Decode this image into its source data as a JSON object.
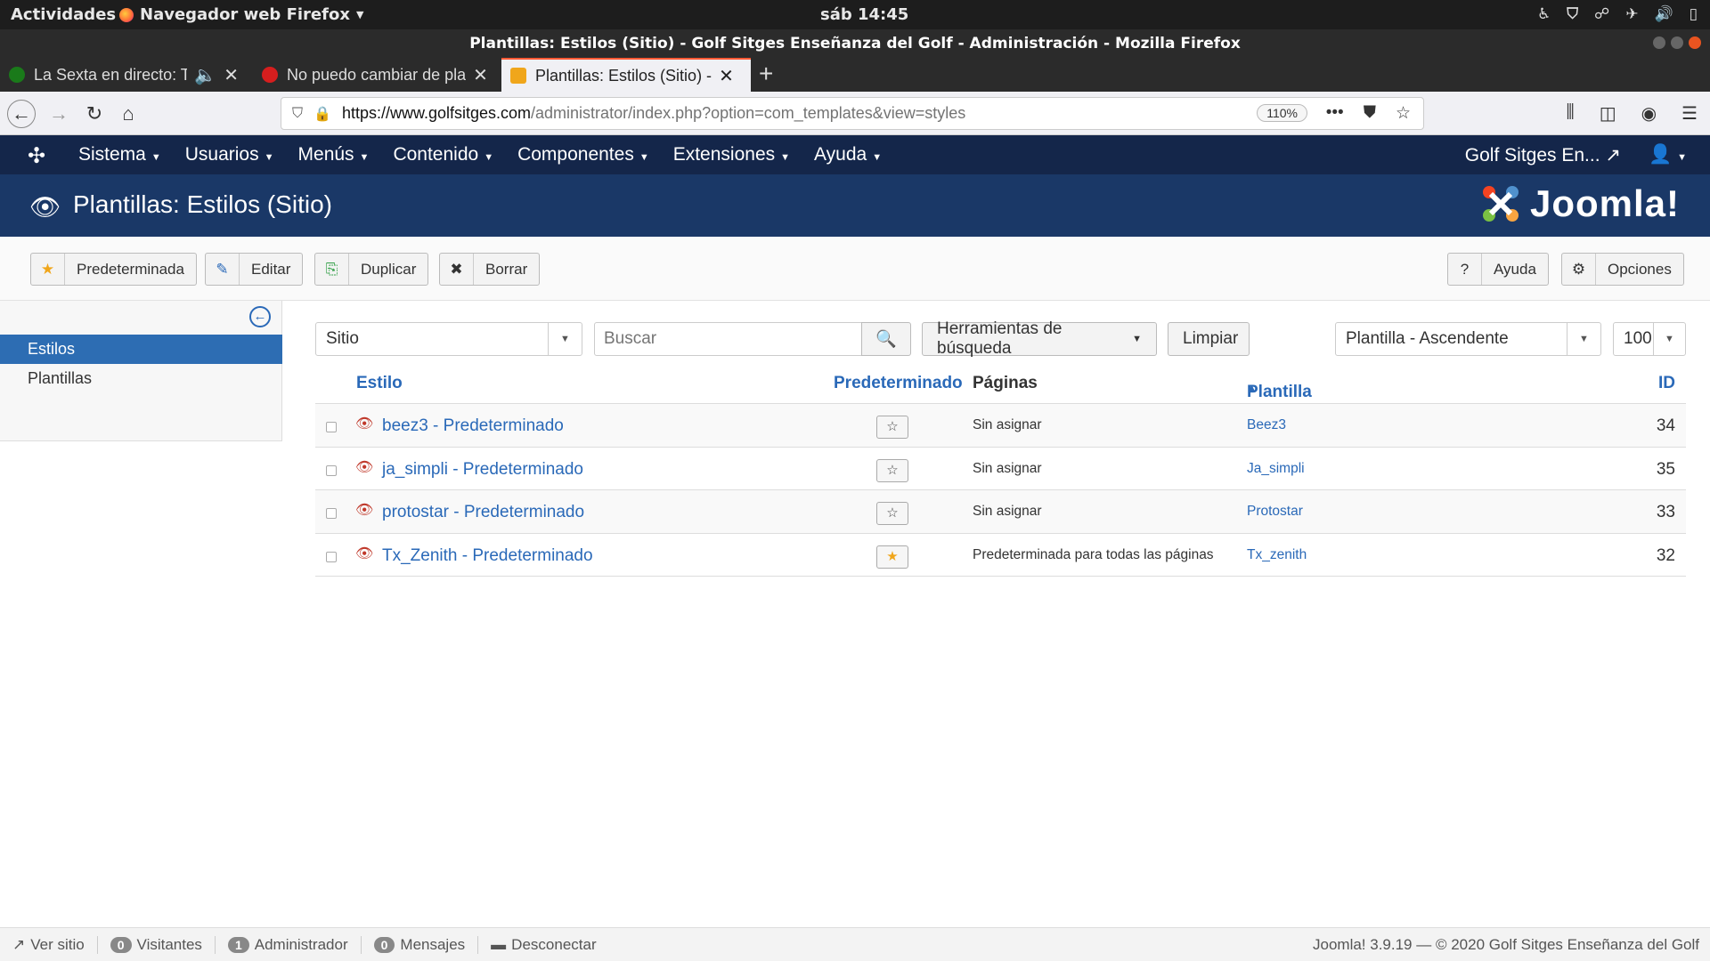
{
  "os": {
    "activities": "Actividades",
    "app_menu": "Navegador web Firefox",
    "clock": "sáb 14:45"
  },
  "browser": {
    "window_title": "Plantillas: Estilos (Sitio) - Golf Sitges Enseñanza del Golf - Administración - Mozilla Firefox",
    "tabs": [
      {
        "label": "La Sexta en directo: To",
        "icon_color": "#1a7a1a"
      },
      {
        "label": "No puedo cambiar de pla",
        "icon_color": "#d61e1e"
      },
      {
        "label": "Plantillas: Estilos (Sitio) -",
        "icon_color": "#f0a61b"
      }
    ],
    "url_host": "https://www.golfsitges.com",
    "url_path": "/administrator/index.php?option=com_templates&view=styles",
    "zoom": "110%"
  },
  "admin_nav": {
    "menu": [
      "Sistema",
      "Usuarios",
      "Menús",
      "Contenido",
      "Componentes",
      "Extensiones",
      "Ayuda"
    ],
    "site_link": "Golf Sitges En..."
  },
  "header": {
    "page_title": "Plantillas: Estilos (Sitio)",
    "brand": "Joomla!"
  },
  "toolbar": {
    "default": "Predeterminada",
    "edit": "Editar",
    "duplicate": "Duplicar",
    "delete": "Borrar",
    "help": "Ayuda",
    "options": "Opciones"
  },
  "sidebar": {
    "items": [
      "Estilos",
      "Plantillas"
    ]
  },
  "filters": {
    "client": "Sitio",
    "search_placeholder": "Buscar",
    "search_tools": "Herramientas de búsqueda",
    "clear": "Limpiar",
    "ordering": "Plantilla - Ascendente",
    "limit": "100"
  },
  "table": {
    "headers": {
      "style": "Estilo",
      "default": "Predeterminado",
      "pages": "Páginas",
      "template": "Plantilla",
      "id": "ID"
    },
    "rows": [
      {
        "name": "beez3 - Predeterminado",
        "is_default": false,
        "pages": "Sin asignar",
        "template": "Beez3",
        "id": "34"
      },
      {
        "name": "ja_simpli - Predeterminado",
        "is_default": false,
        "pages": "Sin asignar",
        "template": "Ja_simpli",
        "id": "35"
      },
      {
        "name": "protostar - Predeterminado",
        "is_default": false,
        "pages": "Sin asignar",
        "template": "Protostar",
        "id": "33"
      },
      {
        "name": "Tx_Zenith - Predeterminado",
        "is_default": true,
        "pages": "Predeterminada para todas las páginas",
        "template": "Tx_zenith",
        "id": "32"
      }
    ]
  },
  "statusbar": {
    "view_site": "Ver sitio",
    "visitors_count": "0",
    "visitors": "Visitantes",
    "admins_count": "1",
    "admins": "Administrador",
    "messages_count": "0",
    "messages": "Mensajes",
    "logout": "Desconectar",
    "footer": "Joomla! 3.9.19 — © 2020 Golf Sitges Enseñanza del Golf"
  },
  "colors": {
    "admin_nav_bg": "#14264a",
    "header_bg": "#1a3867",
    "active_sidebar": "#2d6db3",
    "link": "#2a69b8",
    "default_star": "#f0a61b"
  }
}
